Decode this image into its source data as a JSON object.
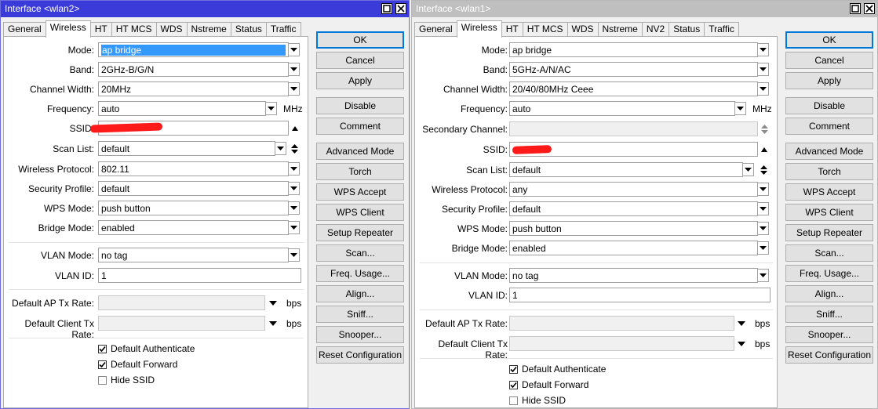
{
  "windows": [
    {
      "title": "Interface <wlan2>",
      "tabs": [
        "General",
        "Wireless",
        "HT",
        "HT MCS",
        "WDS",
        "Nstreme",
        "Status",
        "Traffic"
      ],
      "active_tab": "Wireless",
      "fields": {
        "mode": {
          "label": "Mode:",
          "value": "ap bridge"
        },
        "band": {
          "label": "Band:",
          "value": "2GHz-B/G/N"
        },
        "channel_width": {
          "label": "Channel Width:",
          "value": "20MHz"
        },
        "frequency": {
          "label": "Frequency:",
          "value": "auto",
          "unit": "MHz"
        },
        "ssid": {
          "label": "SSID:",
          "value": ""
        },
        "scan_list": {
          "label": "Scan List:",
          "value": "default"
        },
        "wireless_protocol": {
          "label": "Wireless Protocol:",
          "value": "802.11"
        },
        "security_profile": {
          "label": "Security Profile:",
          "value": "default"
        },
        "wps_mode": {
          "label": "WPS Mode:",
          "value": "push button"
        },
        "bridge_mode": {
          "label": "Bridge Mode:",
          "value": "enabled"
        },
        "vlan_mode": {
          "label": "VLAN Mode:",
          "value": "no tag"
        },
        "vlan_id": {
          "label": "VLAN ID:",
          "value": "1"
        },
        "default_ap_tx_rate": {
          "label": "Default AP Tx Rate:",
          "value": "",
          "unit": "bps"
        },
        "default_client_tx_rate": {
          "label": "Default Client Tx Rate:",
          "value": "",
          "unit": "bps"
        }
      },
      "checkboxes": [
        {
          "label": "Default Authenticate",
          "checked": true
        },
        {
          "label": "Default Forward",
          "checked": true
        },
        {
          "label": "Hide SSID",
          "checked": false
        }
      ],
      "buttons": [
        "OK",
        "Cancel",
        "Apply",
        "Disable",
        "Comment",
        "Advanced Mode",
        "Torch",
        "WPS Accept",
        "WPS Client",
        "Setup Repeater",
        "Scan...",
        "Freq. Usage...",
        "Align...",
        "Sniff...",
        "Snooper...",
        "Reset Configuration"
      ]
    },
    {
      "title": "Interface <wlan1>",
      "tabs": [
        "General",
        "Wireless",
        "HT",
        "HT MCS",
        "WDS",
        "Nstreme",
        "NV2",
        "Status",
        "Traffic"
      ],
      "active_tab": "Wireless",
      "fields": {
        "mode": {
          "label": "Mode:",
          "value": "ap bridge"
        },
        "band": {
          "label": "Band:",
          "value": "5GHz-A/N/AC"
        },
        "channel_width": {
          "label": "Channel Width:",
          "value": "20/40/80MHz Ceee"
        },
        "frequency": {
          "label": "Frequency:",
          "value": "auto",
          "unit": "MHz"
        },
        "secondary_channel": {
          "label": "Secondary Channel:",
          "value": ""
        },
        "ssid": {
          "label": "SSID:",
          "value": ""
        },
        "scan_list": {
          "label": "Scan List:",
          "value": "default"
        },
        "wireless_protocol": {
          "label": "Wireless Protocol:",
          "value": "any"
        },
        "security_profile": {
          "label": "Security Profile:",
          "value": "default"
        },
        "wps_mode": {
          "label": "WPS Mode:",
          "value": "push button"
        },
        "bridge_mode": {
          "label": "Bridge Mode:",
          "value": "enabled"
        },
        "vlan_mode": {
          "label": "VLAN Mode:",
          "value": "no tag"
        },
        "vlan_id": {
          "label": "VLAN ID:",
          "value": "1"
        },
        "default_ap_tx_rate": {
          "label": "Default AP Tx Rate:",
          "value": "",
          "unit": "bps"
        },
        "default_client_tx_rate": {
          "label": "Default Client Tx Rate:",
          "value": "",
          "unit": "bps"
        }
      },
      "checkboxes": [
        {
          "label": "Default Authenticate",
          "checked": true
        },
        {
          "label": "Default Forward",
          "checked": true
        },
        {
          "label": "Hide SSID",
          "checked": false
        }
      ],
      "buttons": [
        "OK",
        "Cancel",
        "Apply",
        "Disable",
        "Comment",
        "Advanced Mode",
        "Torch",
        "WPS Accept",
        "WPS Client",
        "Setup Repeater",
        "Scan...",
        "Freq. Usage...",
        "Align...",
        "Sniff...",
        "Snooper...",
        "Reset Configuration"
      ]
    }
  ],
  "colors": {
    "active_title": "#3b3bd9",
    "inactive_title": "#bfbfbf",
    "selection": "#3399ff",
    "redaction": "#ff1a1a"
  }
}
